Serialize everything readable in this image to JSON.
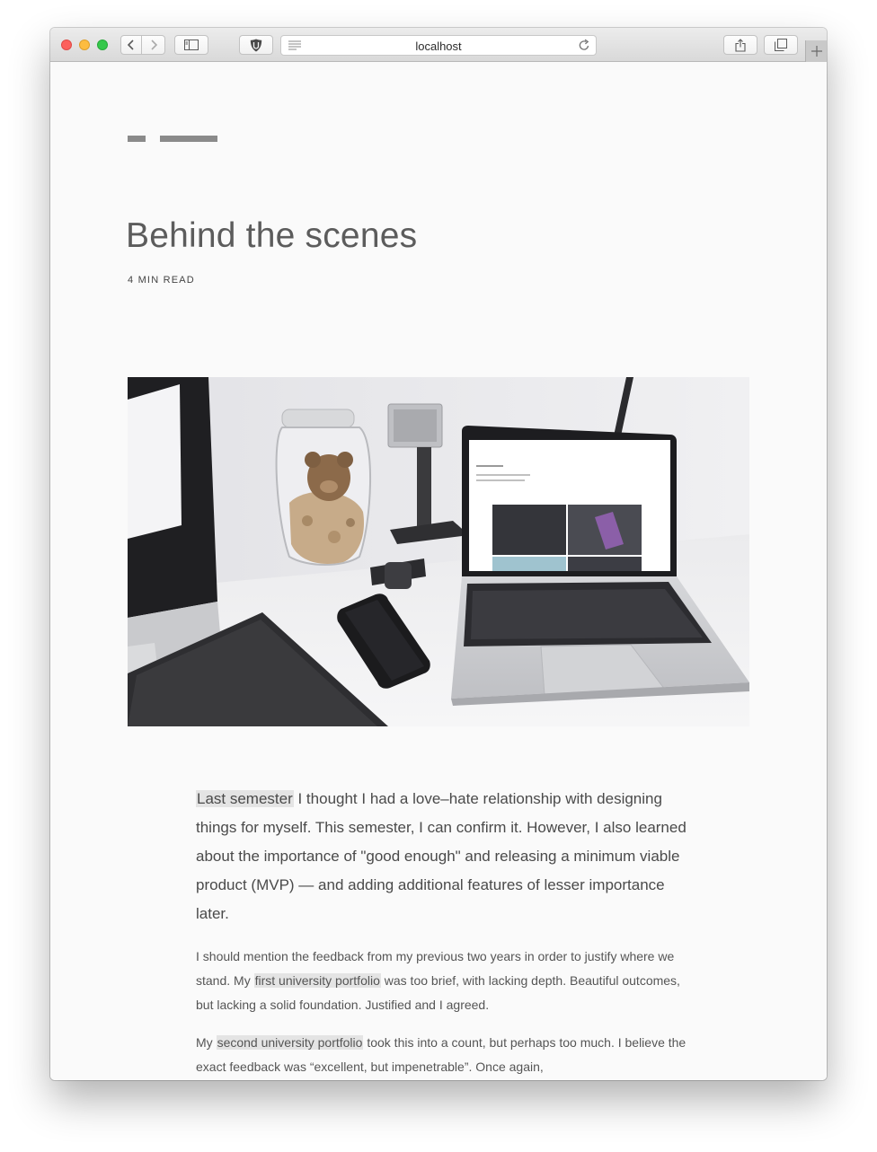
{
  "browser": {
    "url": "localhost",
    "icons": {
      "back": "chevron-left-icon",
      "forward": "chevron-right-icon",
      "sidebar": "sidebar-icon",
      "shield": "shield-icon",
      "reader": "reader-icon",
      "reload": "reload-icon",
      "share": "share-icon",
      "tabs": "tabs-icon",
      "new_tab": "plus-icon"
    }
  },
  "post": {
    "title": "Behind the scenes",
    "read_time": "4 MIN READ",
    "hero_image": "workspace photo: iMac, glass jar with teddy bear, speaker, smartwatch, smartphone, MacBook showing portfolio website"
  },
  "article": {
    "lead": {
      "link": "Last semester",
      "text": " I thought I had a love–hate relationship with designing things for myself. This semester, I can confirm it. However, I also learned about the importance of \"good enough\" and releasing a minimum viable product (MVP) — and adding additional features of lesser importance later."
    },
    "p2": {
      "before": "I should mention the feedback from my previous two years in order to justify where we stand. My ",
      "link": "first university portfolio",
      "after": " was too brief, with lacking depth. Beautiful outcomes, but lacking a solid foundation. Justified and I agreed."
    },
    "p3": {
      "before": "My ",
      "link": "second university portfolio",
      "after": " took this into a count, but perhaps too much. I believe the exact feedback was “excellent, but impenetrable”. Once again,"
    }
  },
  "colors": {
    "background": "#fafafa",
    "title": "#5c5c5c",
    "body_text": "#4a4a4a",
    "link_highlight": "#e4e4e4",
    "logo_mark": "#8a8a8a"
  }
}
